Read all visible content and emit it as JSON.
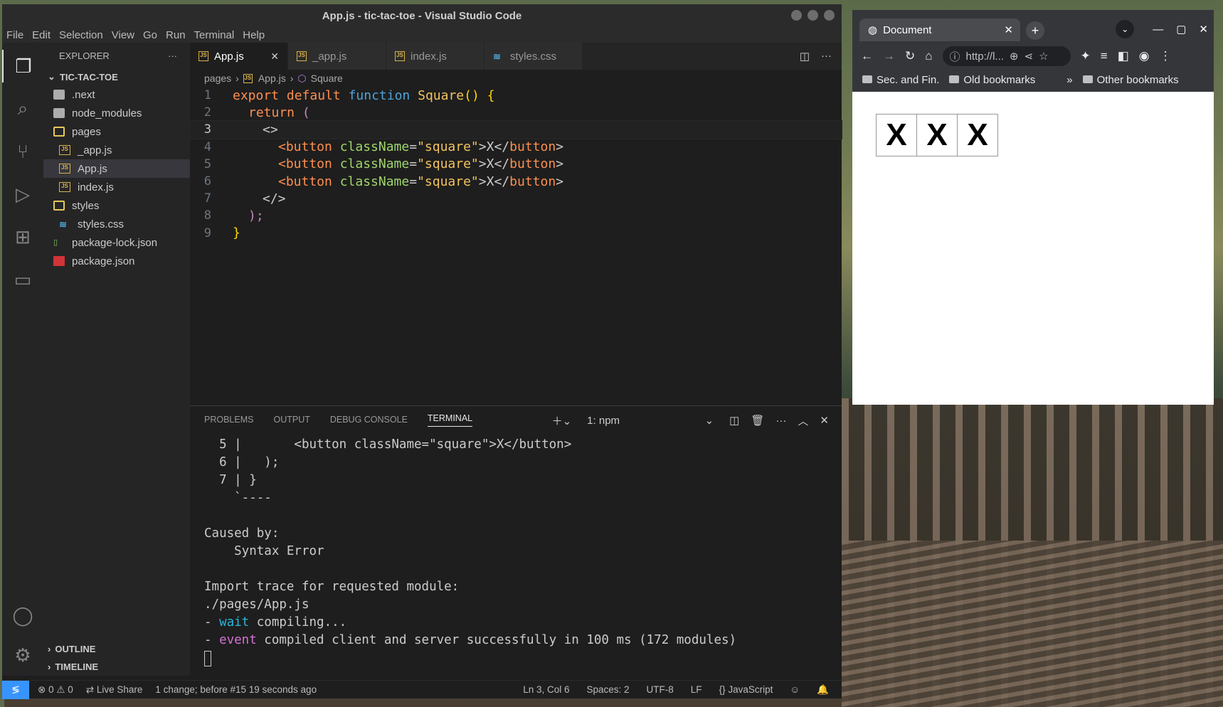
{
  "vscode": {
    "title": "App.js - tic-tac-toe - Visual Studio Code",
    "menu": [
      "File",
      "Edit",
      "Selection",
      "View",
      "Go",
      "Run",
      "Terminal",
      "Help"
    ],
    "explorer": {
      "header": "EXPLORER",
      "project": "TIC-TAC-TOE",
      "items": [
        ".next",
        "node_modules",
        "pages",
        "_app.js",
        "App.js",
        "index.js",
        "styles",
        "styles.css",
        "package-lock.json",
        "package.json"
      ],
      "outline": "OUTLINE",
      "timeline": "TIMELINE"
    },
    "tabs": [
      "App.js",
      "_app.js",
      "index.js",
      "styles.css"
    ],
    "breadcrumb": [
      "pages",
      "App.js",
      "Square"
    ],
    "line_numbers": [
      "1",
      "2",
      "3",
      "4",
      "5",
      "6",
      "7",
      "8",
      "9"
    ],
    "code": {
      "l1_export": "export default ",
      "l1_function": "function ",
      "l1_name": "Square",
      "l1_rest": "() {",
      "l2_return": "return ",
      "l2_paren": "(",
      "l3": "<>",
      "button_open": "<button",
      "attr": " className",
      "eq": "=",
      "value": "\"square\"",
      "text": ">X</",
      "button_close": "button",
      "gt": ">",
      "l7": "</>",
      "l8": ");",
      "l9": "}"
    },
    "panel_tabs": [
      "PROBLEMS",
      "OUTPUT",
      "DEBUG CONSOLE",
      "TERMINAL"
    ],
    "terminal_select": "1: npm",
    "terminal": {
      "l1": "  5 |       <button className=\"square\">X</button>",
      "l2": "  6 |   );",
      "l3": "  7 | }",
      "l4": "    `----",
      "l5": "",
      "l6": "Caused by:",
      "l7": "    Syntax Error",
      "l8": "",
      "l9": "Import trace for requested module:",
      "l10": "./pages/App.js",
      "l11_dash": "- ",
      "l11_key": "wait",
      "l11_rest": " compiling...",
      "l12_dash": "- ",
      "l12_key": "event",
      "l12_rest": " compiled client and server successfully in 100 ms (172 modules)"
    },
    "status": {
      "errors": "0",
      "warnings": "0",
      "live_share": "Live Share",
      "change": "1 change; before #15",
      "time": "19 seconds ago",
      "position": "Ln 3, Col 6",
      "spaces": "Spaces: 2",
      "encoding": "UTF-8",
      "eol": "LF",
      "language": "JavaScript"
    }
  },
  "browser": {
    "tab_title": "Document",
    "url": "http://l...",
    "bookmarks": [
      "Sec. and Fin.",
      "Old bookmarks",
      "Other bookmarks"
    ],
    "squares": [
      "X",
      "X",
      "X"
    ]
  },
  "colors": {
    "accent": "#3794ff",
    "folder": "#e8c85a",
    "js_icon": "#d9b34b"
  }
}
